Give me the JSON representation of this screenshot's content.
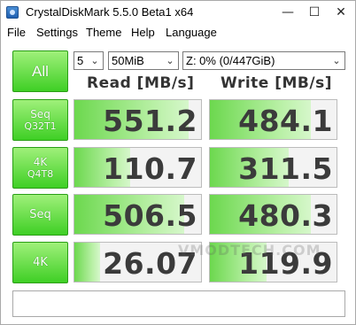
{
  "window": {
    "title": "CrystalDiskMark 5.5.0 Beta1 x64",
    "controls": {
      "minimize": "—",
      "maximize": "☐",
      "close": "✕"
    }
  },
  "menu": [
    "File",
    "Settings",
    "Theme",
    "Help",
    "Language"
  ],
  "toolbar": {
    "all_label": "All",
    "count": "5",
    "size": "50MiB",
    "drive": "Z: 0% (0/447GiB)"
  },
  "headers": {
    "read": "Read [MB/s]",
    "write": "Write [MB/s]"
  },
  "tests": [
    {
      "line1": "Seq",
      "line2": "Q32T1",
      "read": "551.2",
      "write": "484.1",
      "read_fill": 0.9,
      "write_fill": 0.8
    },
    {
      "line1": "4K",
      "line2": "Q4T8",
      "read": "110.7",
      "write": "311.5",
      "read_fill": 0.44,
      "write_fill": 0.62
    },
    {
      "line1": "Seq",
      "line2": "",
      "read": "506.5",
      "write": "480.3",
      "read_fill": 0.87,
      "write_fill": 0.8
    },
    {
      "line1": "4K",
      "line2": "",
      "read": "26.07",
      "write": "119.9",
      "read_fill": 0.2,
      "write_fill": 0.45
    }
  ],
  "watermark": "VMODTECH.COM",
  "comment": "",
  "colors": {
    "accent_green": "#3fcf25",
    "bar_green": "#6cd84e"
  }
}
